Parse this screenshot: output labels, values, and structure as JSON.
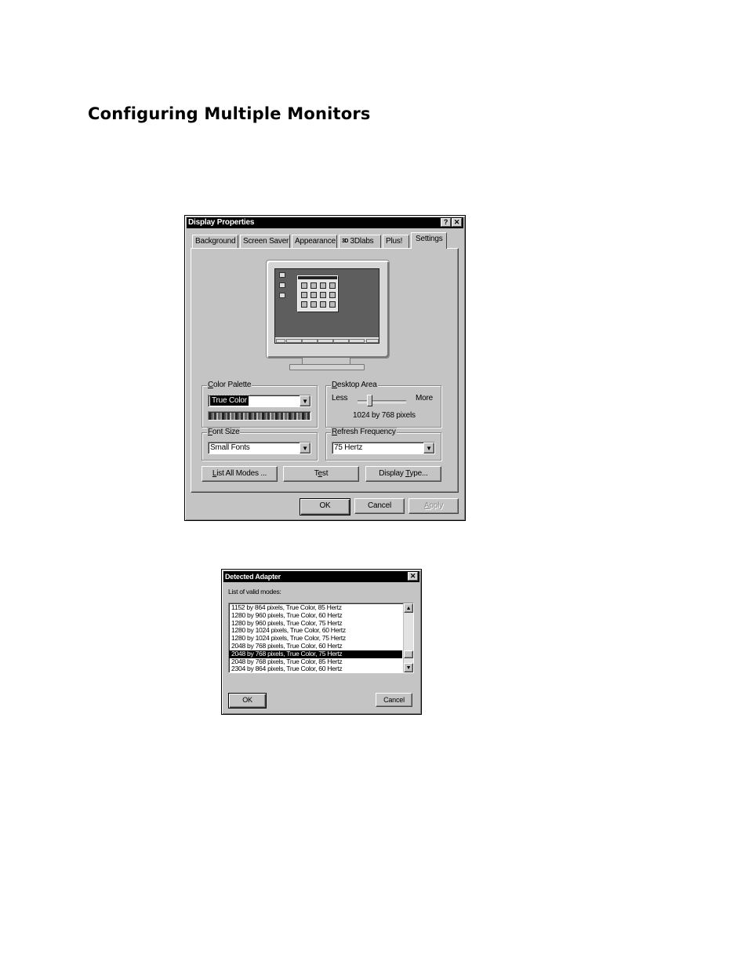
{
  "heading": "Configuring Multiple Monitors",
  "display_properties": {
    "title": "Display Properties",
    "help_button": "?",
    "close_button": "✕",
    "tabs": [
      {
        "label": "Background"
      },
      {
        "label": "Screen Saver"
      },
      {
        "label": "Appearance"
      },
      {
        "label": "3Dlabs",
        "badge": "3D"
      },
      {
        "label": "Plus!"
      },
      {
        "label": "Settings",
        "active": true
      }
    ],
    "color_palette": {
      "label_hotkey": "C",
      "label_rest": "olor Palette",
      "value": "True Color"
    },
    "desktop_area": {
      "label_hotkey": "D",
      "label_rest": "esktop Area",
      "less": "Less",
      "more": "More",
      "resolution": "1024 by 768 pixels",
      "slider_level": 0.25
    },
    "font_size": {
      "label_hotkey": "F",
      "label_rest": "ont Size",
      "value": "Small Fonts"
    },
    "refresh_frequency": {
      "label_hotkey": "R",
      "label_rest": "efresh Frequency",
      "value": "75 Hertz"
    },
    "buttons": {
      "list_modes_hotkey": "L",
      "list_modes_rest": "ist All Modes ...",
      "test_pre": "T",
      "test_hotkey": "e",
      "test_post": "st",
      "display_type_pre": "Display ",
      "display_type_hotkey": "T",
      "display_type_post": "ype...",
      "ok": "OK",
      "cancel": "Cancel",
      "apply_hotkey": "A",
      "apply_rest": "pply"
    }
  },
  "detected_adapter": {
    "title": "Detected Adapter",
    "close_button": "✕",
    "list_label": "List of valid modes:",
    "modes": [
      "1152 by 864 pixels, True Color, 85 Hertz",
      "1280 by 960 pixels, True Color, 60 Hertz",
      "1280 by 960 pixels, True Color, 75 Hertz",
      "1280 by 1024 pixels, True Color, 60 Hertz",
      "1280 by 1024 pixels, True Color, 75 Hertz",
      "2048 by 768 pixels, True Color, 60 Hertz",
      "2048 by 768 pixels, True Color, 75 Hertz",
      "2048 by 768 pixels, True Color, 85 Hertz",
      "2304 by 864 pixels, True Color, 60 Hertz"
    ],
    "selected_index": 6,
    "ok": "OK",
    "cancel": "Cancel"
  },
  "icons": {
    "combo_arrow": "▼",
    "scroll_up": "▲",
    "scroll_down": "▼"
  }
}
